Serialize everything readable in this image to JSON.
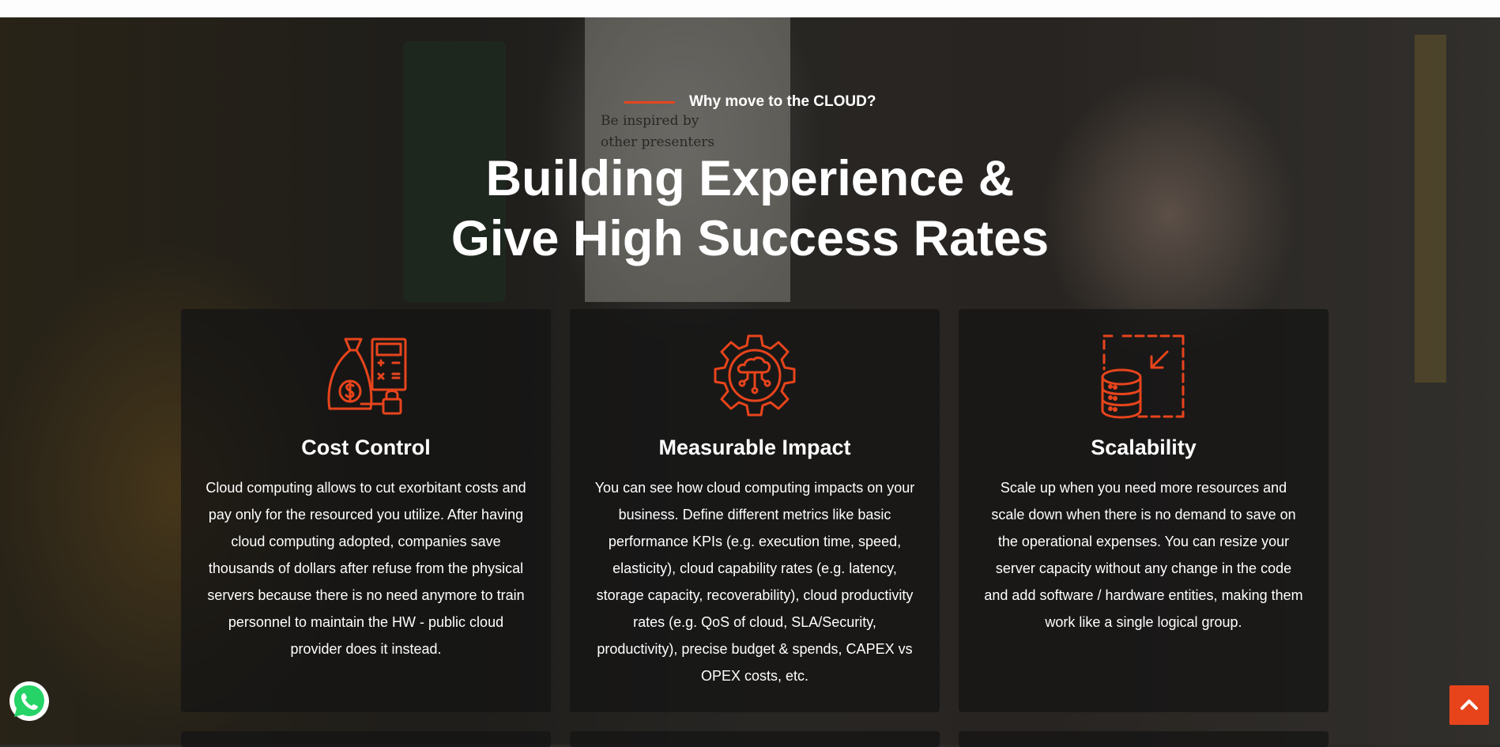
{
  "section": {
    "kicker": "Why move to the CLOUD?",
    "title_line1": "Building Experience &",
    "title_line2": "Give High Success Rates",
    "background_poster_text_line1": "Be inspired by",
    "background_poster_text_line2": "other presenters"
  },
  "cards": [
    {
      "icon": "money-bag-calculator-icon",
      "title": "Cost Control",
      "description": "Cloud computing allows to cut exorbitant costs and pay only for the resourced you utilize. After having cloud computing adopted, companies save thousands of dollars after refuse from the physical servers because there is no need anymore to train personnel to maintain the HW - public cloud provider does it instead."
    },
    {
      "icon": "cloud-gear-icon",
      "title": "Measurable Impact",
      "description": "You can see how cloud computing impacts on your business. Define different metrics like basic performance KPIs (e.g. execution time, speed, elasticity), cloud capability rates (e.g. latency, storage capacity, recoverability), cloud productivity rates (e.g. QoS of cloud, SLA/Security, productivity), precise budget & spends, CAPEX vs OPEX costs, etc."
    },
    {
      "icon": "database-resize-icon",
      "title": "Scalability",
      "description": "Scale up when you need more resources and scale down when there is no demand to save on the operational expenses. You can resize your server capacity without any change in the code and add software / hardware entities, making them work like a single logical group."
    }
  ],
  "colors": {
    "accent": "#e8441c",
    "card_bg": "rgba(20,20,20,0.72)",
    "text": "#ffffff",
    "whatsapp_green": "#25d366"
  },
  "floating": {
    "whatsapp_icon": "whatsapp-icon",
    "back_to_top_icon": "chevron-up-icon"
  }
}
